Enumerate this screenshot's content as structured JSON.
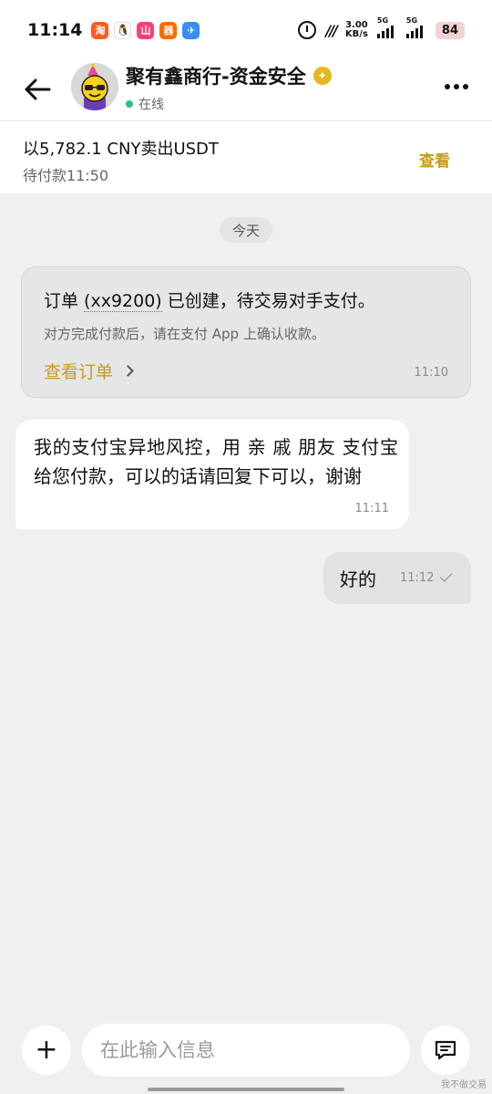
{
  "status_bar": {
    "time": "11:14",
    "app_icons": [
      {
        "name": "taobao-icon",
        "glyph": "淘",
        "class": "ai-taobao"
      },
      {
        "name": "qq-icon",
        "glyph": "🐧",
        "class": "ai-qq"
      },
      {
        "name": "shop-icon",
        "glyph": "山",
        "class": "ai-shop"
      },
      {
        "name": "app-icon",
        "glyph": "器",
        "class": "ai-app"
      },
      {
        "name": "map-icon",
        "glyph": "✈",
        "class": "ai-map"
      }
    ],
    "network_speed_value": "3.00",
    "network_speed_unit": "KB/s",
    "signal_1_label": "5G",
    "signal_2_label": "5G",
    "battery": "84"
  },
  "header": {
    "title": "聚有鑫商行-资金安全",
    "status": "在线"
  },
  "order_bar": {
    "title": "以5,782.1 CNY卖出USDT",
    "subtitle": "待付款11:50",
    "view_label": "查看"
  },
  "chat": {
    "date_label": "今天",
    "system_card": {
      "line1_prefix": "订单 ",
      "order_id": "(xx9200)",
      "line1_suffix": " 已创建，待交易对手支付。",
      "line2": "对方完成付款后，请在支付 App 上确认收款。",
      "link_label": "查看订单",
      "time": "11:10"
    },
    "incoming": {
      "text": "我的支付宝异地风控，用 亲 戚 朋友 支付宝 给您付款，可以的话请回复下可以，谢谢",
      "time": "11:11"
    },
    "outgoing": {
      "text": "好的",
      "time": "11:12"
    }
  },
  "input_bar": {
    "placeholder": "在此输入信息"
  },
  "watermark": "我不做交易",
  "colors": {
    "accent": "#c99a1b",
    "online": "#2ebd85",
    "verified": "#e5b81e"
  }
}
